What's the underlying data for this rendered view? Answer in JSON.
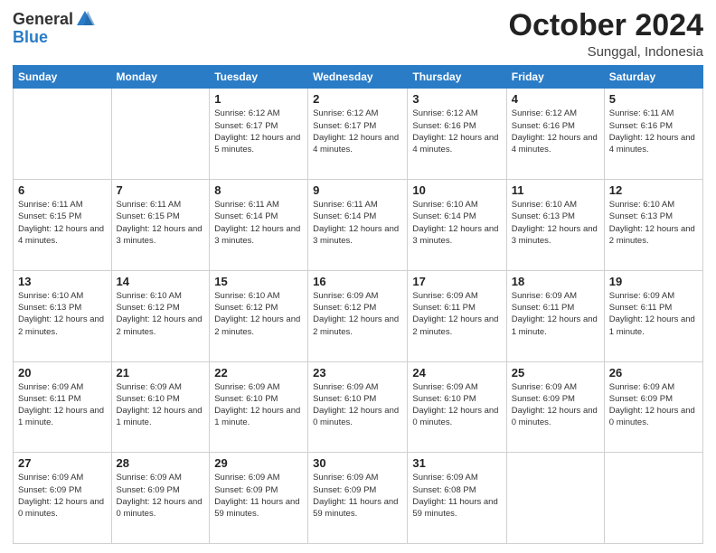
{
  "logo": {
    "text_general": "General",
    "text_blue": "Blue"
  },
  "header": {
    "month_title": "October 2024",
    "subtitle": "Sunggal, Indonesia"
  },
  "weekdays": [
    "Sunday",
    "Monday",
    "Tuesday",
    "Wednesday",
    "Thursday",
    "Friday",
    "Saturday"
  ],
  "weeks": [
    [
      {
        "day": "",
        "info": ""
      },
      {
        "day": "",
        "info": ""
      },
      {
        "day": "1",
        "info": "Sunrise: 6:12 AM\nSunset: 6:17 PM\nDaylight: 12 hours and 5 minutes."
      },
      {
        "day": "2",
        "info": "Sunrise: 6:12 AM\nSunset: 6:17 PM\nDaylight: 12 hours and 4 minutes."
      },
      {
        "day": "3",
        "info": "Sunrise: 6:12 AM\nSunset: 6:16 PM\nDaylight: 12 hours and 4 minutes."
      },
      {
        "day": "4",
        "info": "Sunrise: 6:12 AM\nSunset: 6:16 PM\nDaylight: 12 hours and 4 minutes."
      },
      {
        "day": "5",
        "info": "Sunrise: 6:11 AM\nSunset: 6:16 PM\nDaylight: 12 hours and 4 minutes."
      }
    ],
    [
      {
        "day": "6",
        "info": "Sunrise: 6:11 AM\nSunset: 6:15 PM\nDaylight: 12 hours and 4 minutes."
      },
      {
        "day": "7",
        "info": "Sunrise: 6:11 AM\nSunset: 6:15 PM\nDaylight: 12 hours and 3 minutes."
      },
      {
        "day": "8",
        "info": "Sunrise: 6:11 AM\nSunset: 6:14 PM\nDaylight: 12 hours and 3 minutes."
      },
      {
        "day": "9",
        "info": "Sunrise: 6:11 AM\nSunset: 6:14 PM\nDaylight: 12 hours and 3 minutes."
      },
      {
        "day": "10",
        "info": "Sunrise: 6:10 AM\nSunset: 6:14 PM\nDaylight: 12 hours and 3 minutes."
      },
      {
        "day": "11",
        "info": "Sunrise: 6:10 AM\nSunset: 6:13 PM\nDaylight: 12 hours and 3 minutes."
      },
      {
        "day": "12",
        "info": "Sunrise: 6:10 AM\nSunset: 6:13 PM\nDaylight: 12 hours and 2 minutes."
      }
    ],
    [
      {
        "day": "13",
        "info": "Sunrise: 6:10 AM\nSunset: 6:13 PM\nDaylight: 12 hours and 2 minutes."
      },
      {
        "day": "14",
        "info": "Sunrise: 6:10 AM\nSunset: 6:12 PM\nDaylight: 12 hours and 2 minutes."
      },
      {
        "day": "15",
        "info": "Sunrise: 6:10 AM\nSunset: 6:12 PM\nDaylight: 12 hours and 2 minutes."
      },
      {
        "day": "16",
        "info": "Sunrise: 6:09 AM\nSunset: 6:12 PM\nDaylight: 12 hours and 2 minutes."
      },
      {
        "day": "17",
        "info": "Sunrise: 6:09 AM\nSunset: 6:11 PM\nDaylight: 12 hours and 2 minutes."
      },
      {
        "day": "18",
        "info": "Sunrise: 6:09 AM\nSunset: 6:11 PM\nDaylight: 12 hours and 1 minute."
      },
      {
        "day": "19",
        "info": "Sunrise: 6:09 AM\nSunset: 6:11 PM\nDaylight: 12 hours and 1 minute."
      }
    ],
    [
      {
        "day": "20",
        "info": "Sunrise: 6:09 AM\nSunset: 6:11 PM\nDaylight: 12 hours and 1 minute."
      },
      {
        "day": "21",
        "info": "Sunrise: 6:09 AM\nSunset: 6:10 PM\nDaylight: 12 hours and 1 minute."
      },
      {
        "day": "22",
        "info": "Sunrise: 6:09 AM\nSunset: 6:10 PM\nDaylight: 12 hours and 1 minute."
      },
      {
        "day": "23",
        "info": "Sunrise: 6:09 AM\nSunset: 6:10 PM\nDaylight: 12 hours and 0 minutes."
      },
      {
        "day": "24",
        "info": "Sunrise: 6:09 AM\nSunset: 6:10 PM\nDaylight: 12 hours and 0 minutes."
      },
      {
        "day": "25",
        "info": "Sunrise: 6:09 AM\nSunset: 6:09 PM\nDaylight: 12 hours and 0 minutes."
      },
      {
        "day": "26",
        "info": "Sunrise: 6:09 AM\nSunset: 6:09 PM\nDaylight: 12 hours and 0 minutes."
      }
    ],
    [
      {
        "day": "27",
        "info": "Sunrise: 6:09 AM\nSunset: 6:09 PM\nDaylight: 12 hours and 0 minutes."
      },
      {
        "day": "28",
        "info": "Sunrise: 6:09 AM\nSunset: 6:09 PM\nDaylight: 12 hours and 0 minutes."
      },
      {
        "day": "29",
        "info": "Sunrise: 6:09 AM\nSunset: 6:09 PM\nDaylight: 11 hours and 59 minutes."
      },
      {
        "day": "30",
        "info": "Sunrise: 6:09 AM\nSunset: 6:09 PM\nDaylight: 11 hours and 59 minutes."
      },
      {
        "day": "31",
        "info": "Sunrise: 6:09 AM\nSunset: 6:08 PM\nDaylight: 11 hours and 59 minutes."
      },
      {
        "day": "",
        "info": ""
      },
      {
        "day": "",
        "info": ""
      }
    ]
  ]
}
